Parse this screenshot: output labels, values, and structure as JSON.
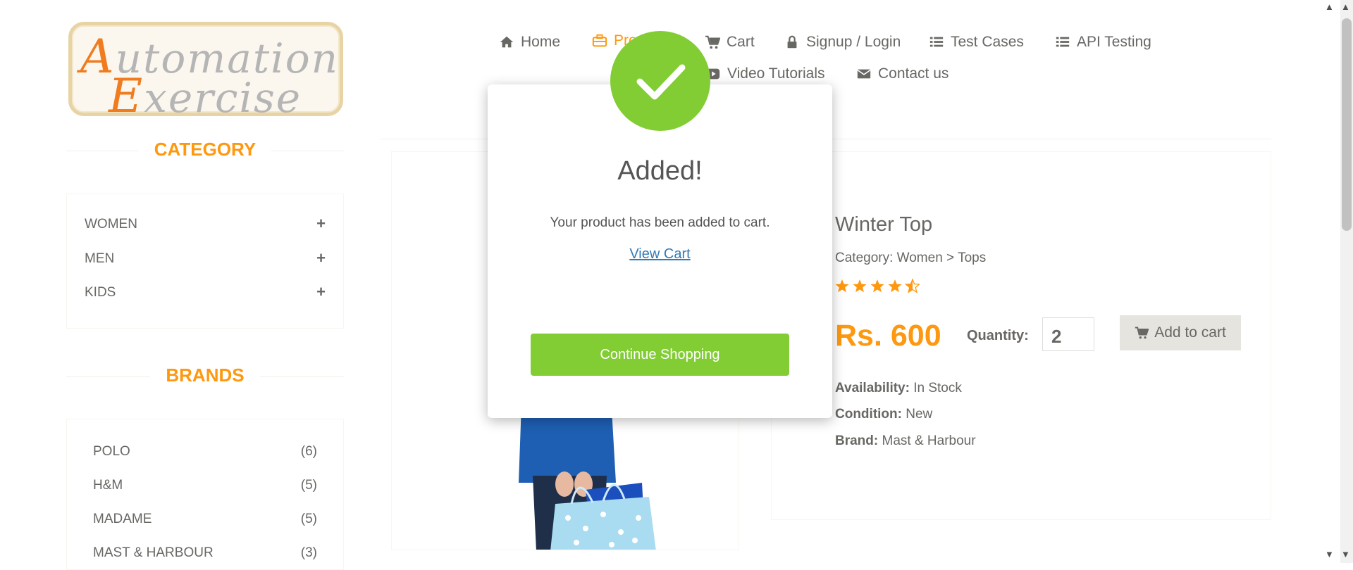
{
  "logo": {
    "line1_cap": "A",
    "line1_rest": "utomation",
    "line2_cap": "E",
    "line2_rest": "xercise"
  },
  "nav": {
    "home": {
      "label": "Home",
      "icon": "home-icon"
    },
    "products": {
      "label": "Products",
      "icon": "briefcase-icon",
      "color": "#fe980f"
    },
    "cart": {
      "label": "Cart",
      "icon": "cart-icon"
    },
    "login": {
      "label": "Signup / Login",
      "icon": "lock-icon"
    },
    "test_cases": {
      "label": "Test Cases",
      "icon": "list-icon"
    },
    "api_testing": {
      "label": "API Testing",
      "icon": "list-icon"
    },
    "video": {
      "label": "Video Tutorials",
      "icon": "youtube-play-icon"
    },
    "contact": {
      "label": "Contact us",
      "icon": "envelope-icon"
    }
  },
  "sidebar": {
    "category_title": "CATEGORY",
    "categories": [
      {
        "label": "WOMEN",
        "toggle": "+"
      },
      {
        "label": "MEN",
        "toggle": "+"
      },
      {
        "label": "KIDS",
        "toggle": "+"
      }
    ],
    "brands_title": "BRANDS",
    "brands": [
      {
        "label": "POLO",
        "count": "(6)"
      },
      {
        "label": "H&M",
        "count": "(5)"
      },
      {
        "label": "MADAME",
        "count": "(5)"
      },
      {
        "label": "MAST & HARBOUR",
        "count": "(3)"
      }
    ]
  },
  "product": {
    "title": "Winter Top",
    "category": "Category: Women > Tops",
    "rating": 4.5,
    "price": "Rs. 600",
    "quantity_label": "Quantity:",
    "quantity_value": "2",
    "add_to_cart": "Add to cart",
    "availability_label": "Availability:",
    "availability_value": "In Stock",
    "condition_label": "Condition:",
    "condition_value": "New",
    "brand_label": "Brand:",
    "brand_value": "Mast & Harbour"
  },
  "modal": {
    "title": "Added!",
    "message": "Your product has been added to cart.",
    "link": "View Cart",
    "button": "Continue Shopping",
    "accent": "#82cd34"
  },
  "colors": {
    "brand_orange": "#fe980f",
    "text_gray": "#696763",
    "link_blue": "#337ab7"
  }
}
